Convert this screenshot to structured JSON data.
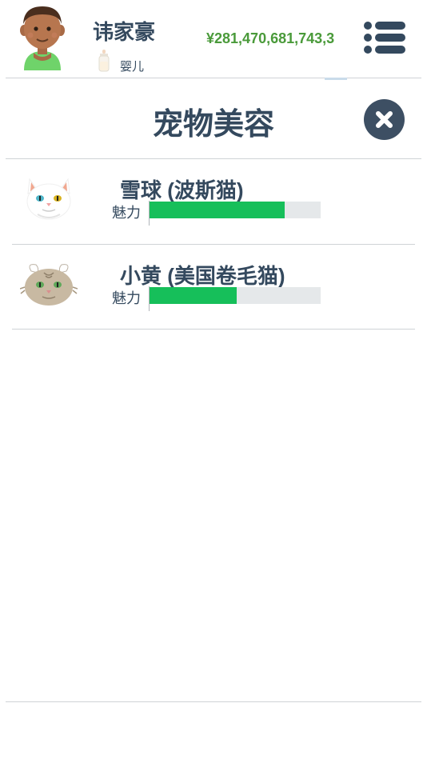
{
  "header": {
    "player_name": "讳家豪",
    "life_stage": "婴儿",
    "money": "¥281,470,681,743,3"
  },
  "page": {
    "title": "宠物美容"
  },
  "pets": [
    {
      "name": "雪球 (波斯猫)",
      "stat_label": "魅力",
      "charm": 0.79
    },
    {
      "name": "小黄 (美国卷毛猫)",
      "stat_label": "魅力",
      "charm": 0.51
    }
  ],
  "colors": {
    "accent_text": "#34495e",
    "money": "#4a9a3a",
    "bar_fill": "#16bf5a",
    "bar_track": "#e5e8ea",
    "close_button": "#3d4f63"
  },
  "icons": [
    "avatar",
    "baby-bottle-icon",
    "menu-icon",
    "close-icon",
    "persian-cat-icon",
    "curl-cat-icon"
  ]
}
